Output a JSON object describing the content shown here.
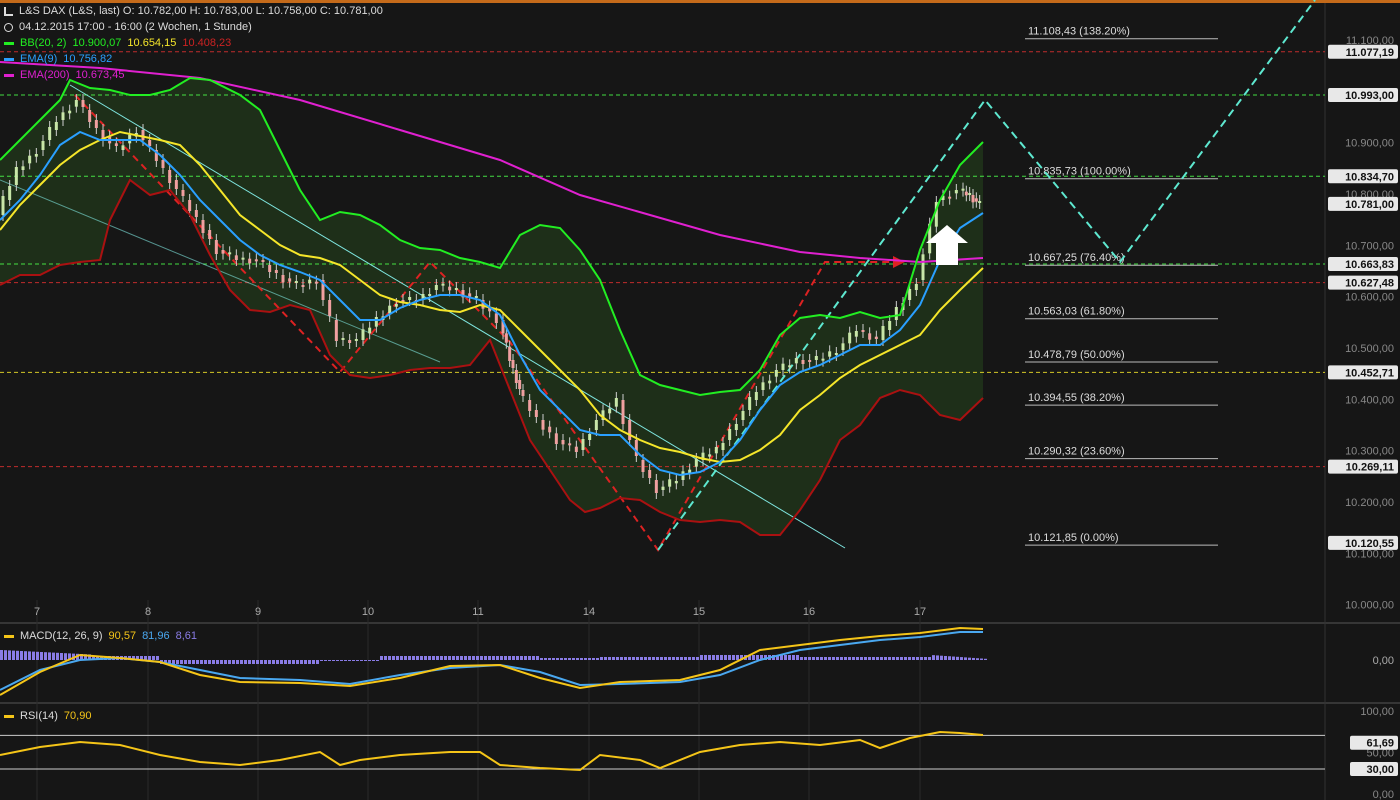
{
  "header": {
    "line1": "L&S DAX (L&S, last)  O: 10.782,00  H: 10.783,00  L: 10.758,00  C: 10.781,00",
    "line2": "04.12.2015 17:00 - 16:00 (2 Wochen, 1 Stunde)",
    "bb_name": "BB(20, 2)",
    "bb_upper": "10.900,07",
    "bb_mid": "10.654,15",
    "bb_lower": "10.408,23",
    "ema9_name": "EMA(9)",
    "ema9_value": "10.756,82",
    "ema200_name": "EMA(200)",
    "ema200_value": "10.673,45"
  },
  "colors": {
    "background": "#161616",
    "bb_band": "#22ee22",
    "bb_lower": "#aa1111",
    "bb_mid": "#f5e62a",
    "bb_fill": "#1f3219",
    "ema9": "#2aa0ff",
    "ema200": "#e020d0",
    "candle_up": "#c8e6a8",
    "candle_down": "#f0a0a0",
    "fib_line": "#bbbbbb",
    "resistance_green": "#4cff4c",
    "resistance_red": "#dd3030",
    "projection": "#5ee8d0",
    "macd_hist": "#8a7ce6",
    "signal": "#4aa8f0",
    "macd_line": "#f5c518",
    "rsi_line": "#f5c518"
  },
  "chart_data": [
    {
      "type": "candlestick",
      "name": "main",
      "x_labels": [
        "7",
        "8",
        "9",
        "10",
        "11",
        "14",
        "15",
        "16",
        "17"
      ],
      "ylim": [
        10000,
        11120
      ],
      "y_ticks": [
        "11.100,00",
        "10.900,00",
        "10.800,00",
        "10.700,00",
        "10.600,00",
        "10.500,00",
        "10.400,00",
        "10.300,00",
        "10.200,00",
        "10.100,00",
        "10.000,00"
      ],
      "price_markers": [
        {
          "label": "11.077,19",
          "value": 11077.19,
          "color": "#dd3030"
        },
        {
          "label": "10.993,00",
          "value": 10993.0,
          "color": "#4cff4c"
        },
        {
          "label": "10.834,70",
          "value": 10834.7,
          "color": "#4cff4c"
        },
        {
          "label": "10.781,00",
          "value": 10781.0,
          "color": "#ffffff"
        },
        {
          "label": "10.663,83",
          "value": 10663.83,
          "color": "#4cff4c"
        },
        {
          "label": "10.627,48",
          "value": 10627.48,
          "color": "#dd3030"
        },
        {
          "label": "10.452,71",
          "value": 10452.71,
          "color": "#f5e62a"
        },
        {
          "label": "10.269,11",
          "value": 10269.11,
          "color": "#dd3030"
        },
        {
          "label": "10.120,55",
          "value": 10120.55,
          "color": "#ffffff"
        }
      ],
      "fibonacci": [
        {
          "label": "11.108,43 (138.20%)",
          "value": 11108.43
        },
        {
          "label": "10.835,73 (100.00%)",
          "value": 10835.73
        },
        {
          "label": "10.667,25 (76.40%)",
          "value": 10667.25
        },
        {
          "label": "10.563,03 (61.80%)",
          "value": 10563.03
        },
        {
          "label": "10.478,79 (50.00%)",
          "value": 10478.79
        },
        {
          "label": "10.394,55 (38.20%)",
          "value": 10394.55
        },
        {
          "label": "10.290,32 (23.60%)",
          "value": 10290.32
        },
        {
          "label": "10.121,85 (0.00%)",
          "value": 10121.85
        }
      ],
      "ohlc_last": {
        "open": 10782.0,
        "high": 10783.0,
        "low": 10758.0,
        "close": 10781.0
      }
    },
    {
      "type": "line",
      "name": "macd",
      "title": "MACD(12, 26, 9)",
      "series": [
        {
          "name": "MACD",
          "value": "90,57"
        },
        {
          "name": "Signal",
          "value": "81,96"
        },
        {
          "name": "Histogram",
          "value": "8,61"
        }
      ],
      "y_ticks": [
        "0,00"
      ]
    },
    {
      "type": "line",
      "name": "rsi",
      "title": "RSI(14)",
      "value": "70,90",
      "y_ticks": [
        "100,00",
        "50,00",
        "0,00"
      ],
      "markers": [
        "61,69",
        "30,00"
      ],
      "ylim": [
        0,
        100
      ]
    }
  ]
}
